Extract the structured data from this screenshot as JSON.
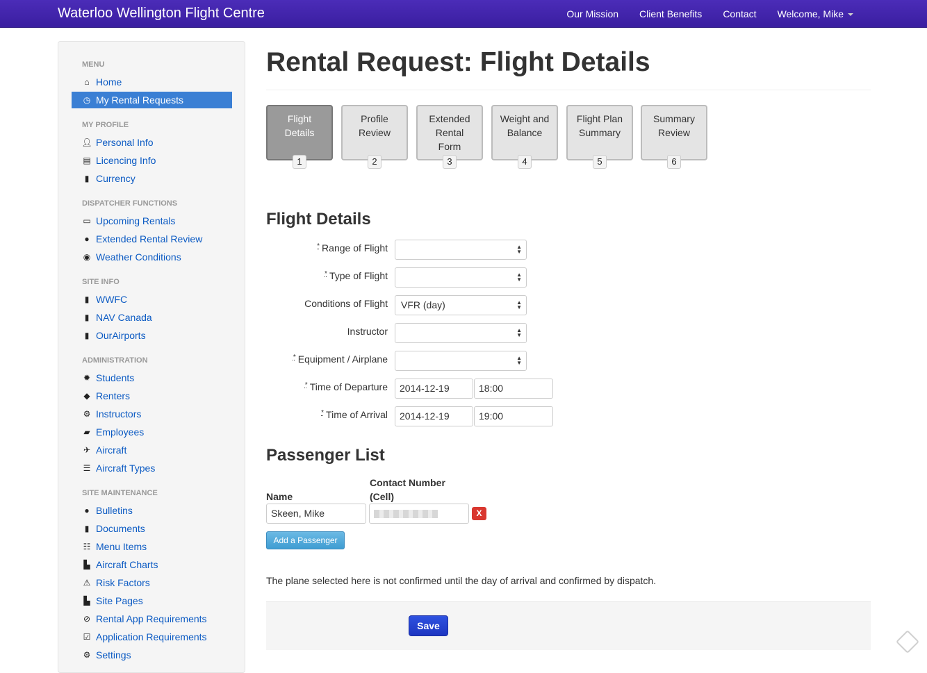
{
  "navbar": {
    "brand": "Waterloo Wellington Flight Centre",
    "links": [
      "Our Mission",
      "Client Benefits",
      "Contact"
    ],
    "user": "Welcome, Mike"
  },
  "sidebar": {
    "menu_header": "MENU",
    "menu": [
      {
        "label": "Home",
        "icon": "home-icon"
      },
      {
        "label": "My Rental Requests",
        "icon": "clock-icon",
        "active": true
      }
    ],
    "profile_header": "MY PROFILE",
    "profile": [
      {
        "label": "Personal Info",
        "icon": "user-icon"
      },
      {
        "label": "Licencing Info",
        "icon": "list-alt-icon"
      },
      {
        "label": "Currency",
        "icon": "book-icon"
      }
    ],
    "dispatcher_header": "DISPATCHER FUNCTIONS",
    "dispatcher": [
      {
        "label": "Upcoming Rentals",
        "icon": "inbox-icon"
      },
      {
        "label": "Extended Rental Review",
        "icon": "map-marker-icon"
      },
      {
        "label": "Weather Conditions",
        "icon": "globe-icon"
      }
    ],
    "siteinfo_header": "SITE INFO",
    "siteinfo": [
      {
        "label": "WWFC",
        "icon": "bookmark-icon"
      },
      {
        "label": "NAV Canada",
        "icon": "bookmark-icon"
      },
      {
        "label": "OurAirports",
        "icon": "bookmark-icon"
      }
    ],
    "admin_header": "ADMINISTRATION",
    "admin": [
      {
        "label": "Students",
        "icon": "certificate-icon"
      },
      {
        "label": "Renters",
        "icon": "tags-icon"
      },
      {
        "label": "Instructors",
        "icon": "cog-icon"
      },
      {
        "label": "Employees",
        "icon": "folder-open-icon"
      },
      {
        "label": "Aircraft",
        "icon": "plane-icon"
      },
      {
        "label": "Aircraft Types",
        "icon": "align-justify-icon"
      }
    ],
    "maint_header": "SITE MAINTENANCE",
    "maint": [
      {
        "label": "Bulletins",
        "icon": "info-sign-icon"
      },
      {
        "label": "Documents",
        "icon": "book-icon"
      },
      {
        "label": "Menu Items",
        "icon": "th-list-icon"
      },
      {
        "label": "Aircraft Charts",
        "icon": "file-icon"
      },
      {
        "label": "Risk Factors",
        "icon": "warning-sign-icon"
      },
      {
        "label": "Site Pages",
        "icon": "file-icon"
      },
      {
        "label": "Rental App Requirements",
        "icon": "ok-circle-icon"
      },
      {
        "label": "Application Requirements",
        "icon": "check-icon"
      },
      {
        "label": "Settings",
        "icon": "cog-icon"
      }
    ]
  },
  "page": {
    "title": "Rental Request: Flight Details"
  },
  "steps": [
    {
      "line1": "Flight",
      "line2": "Details",
      "line3": "",
      "num": "1",
      "active": true
    },
    {
      "line1": "Profile",
      "line2": "Review",
      "line3": "",
      "num": "2"
    },
    {
      "line1": "Extended",
      "line2": "Rental",
      "line3": "Form",
      "num": "3"
    },
    {
      "line1": "Weight and",
      "line2": "Balance",
      "line3": "",
      "num": "4"
    },
    {
      "line1": "Flight Plan",
      "line2": "Summary",
      "line3": "",
      "num": "5"
    },
    {
      "line1": "Summary",
      "line2": "Review",
      "line3": "",
      "num": "6"
    }
  ],
  "flight_details": {
    "heading": "Flight Details",
    "required_mark": "*",
    "range_label": "Range of Flight",
    "range_value": "",
    "type_label": "Type of Flight",
    "type_value": "",
    "conditions_label": "Conditions of Flight",
    "conditions_value": "VFR (day)",
    "instructor_label": "Instructor",
    "instructor_value": "",
    "equipment_label": "Equipment / Airplane",
    "equipment_value": "",
    "departure_label": "Time of Departure",
    "departure_date": "2014-12-19",
    "departure_time": "18:00",
    "arrival_label": "Time of Arrival",
    "arrival_date": "2014-12-19",
    "arrival_time": "19:00"
  },
  "passengers": {
    "heading": "Passenger List",
    "name_header": "Name",
    "contact_header_1": "Contact Number",
    "contact_header_2": "(Cell)",
    "name_value": "Skeen, Mike",
    "remove_label": "X",
    "add_label": "Add a Passenger"
  },
  "note": "The plane selected here is not confirmed until the day of arrival and confirmed by dispatch.",
  "save_label": "Save"
}
